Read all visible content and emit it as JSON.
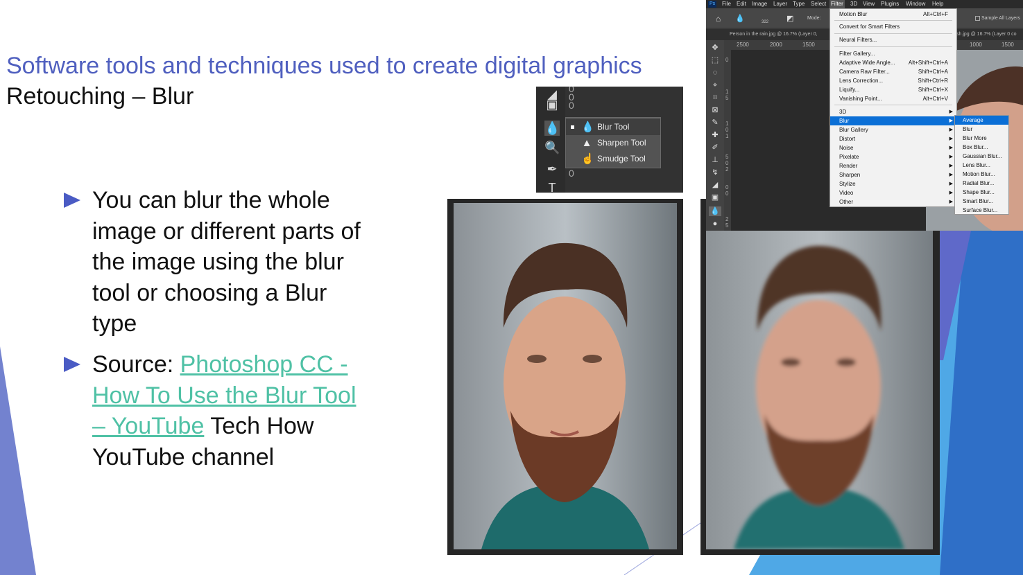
{
  "slide": {
    "title": "Software tools and techniques used to create digital graphics",
    "subtitle": "Retouching – Blur",
    "bullet1": "You can blur the whole image or different parts of the image using the blur tool or choosing a Blur type",
    "bullet2_prefix": "Source: ",
    "bullet2_link": "Photoshop CC - How To Use the Blur Tool – YouTube",
    "bullet2_suffix": " Tech How YouTube channel"
  },
  "colors": {
    "title": "#4f5fbf",
    "link": "#4fc1a5",
    "bullet": "#4a5bc4",
    "accent_blue": "#2f9ae0"
  },
  "tool_flyout": {
    "items": [
      {
        "label": "Blur Tool",
        "icon": "drop-icon",
        "selected": true
      },
      {
        "label": "Sharpen Tool",
        "icon": "triangle-icon",
        "selected": false
      },
      {
        "label": "Smudge Tool",
        "icon": "finger-icon",
        "selected": false
      }
    ],
    "strip_values": [
      "0",
      "0",
      "0",
      "0"
    ]
  },
  "photoshop": {
    "app_icon": "Ps",
    "menus": [
      "File",
      "Edit",
      "Image",
      "Layer",
      "Type",
      "Select",
      "Filter",
      "3D",
      "View",
      "Plugins",
      "Window",
      "Help"
    ],
    "options": {
      "brush_size": "322",
      "mode_label": "Mode:",
      "sample_all_layers": "Sample All Layers"
    },
    "tab_left": "Person in the rain.jpg @ 16.7% (Layer 0,",
    "tab_right": "sh.jpg @ 16.7% (Layer 0 co",
    "ruler_left": [
      "2500",
      "2000",
      "1500"
    ],
    "ruler_right": [
      "1000",
      "1500"
    ],
    "vruler": [
      "0",
      "1",
      "5",
      "1",
      "0",
      "1",
      "5",
      "0",
      "2",
      "0",
      "0",
      "2",
      "5"
    ],
    "filter_menu": [
      {
        "label": "Motion Blur",
        "shortcut": "Alt+Ctrl+F"
      },
      {
        "label": "Convert for Smart Filters",
        "shortcut": ""
      },
      {
        "label": "Neural Filters...",
        "shortcut": ""
      },
      {
        "label": "Filter Gallery...",
        "shortcut": ""
      },
      {
        "label": "Adaptive Wide Angle...",
        "shortcut": "Alt+Shift+Ctrl+A"
      },
      {
        "label": "Camera Raw Filter...",
        "shortcut": "Shift+Ctrl+A"
      },
      {
        "label": "Lens Correction...",
        "shortcut": "Shift+Ctrl+R"
      },
      {
        "label": "Liquify...",
        "shortcut": "Shift+Ctrl+X"
      },
      {
        "label": "Vanishing Point...",
        "shortcut": "Alt+Ctrl+V"
      },
      {
        "label": "3D",
        "shortcut": ""
      },
      {
        "label": "Blur",
        "shortcut": ""
      },
      {
        "label": "Blur Gallery",
        "shortcut": ""
      },
      {
        "label": "Distort",
        "shortcut": ""
      },
      {
        "label": "Noise",
        "shortcut": ""
      },
      {
        "label": "Pixelate",
        "shortcut": ""
      },
      {
        "label": "Render",
        "shortcut": ""
      },
      {
        "label": "Sharpen",
        "shortcut": ""
      },
      {
        "label": "Stylize",
        "shortcut": ""
      },
      {
        "label": "Video",
        "shortcut": ""
      },
      {
        "label": "Other",
        "shortcut": ""
      }
    ],
    "blur_submenu": [
      "Average",
      "Blur",
      "Blur More",
      "Box Blur...",
      "Gaussian Blur...",
      "Lens Blur...",
      "Motion Blur...",
      "Radial Blur...",
      "Shape Blur...",
      "Smart Blur...",
      "Surface Blur..."
    ]
  }
}
